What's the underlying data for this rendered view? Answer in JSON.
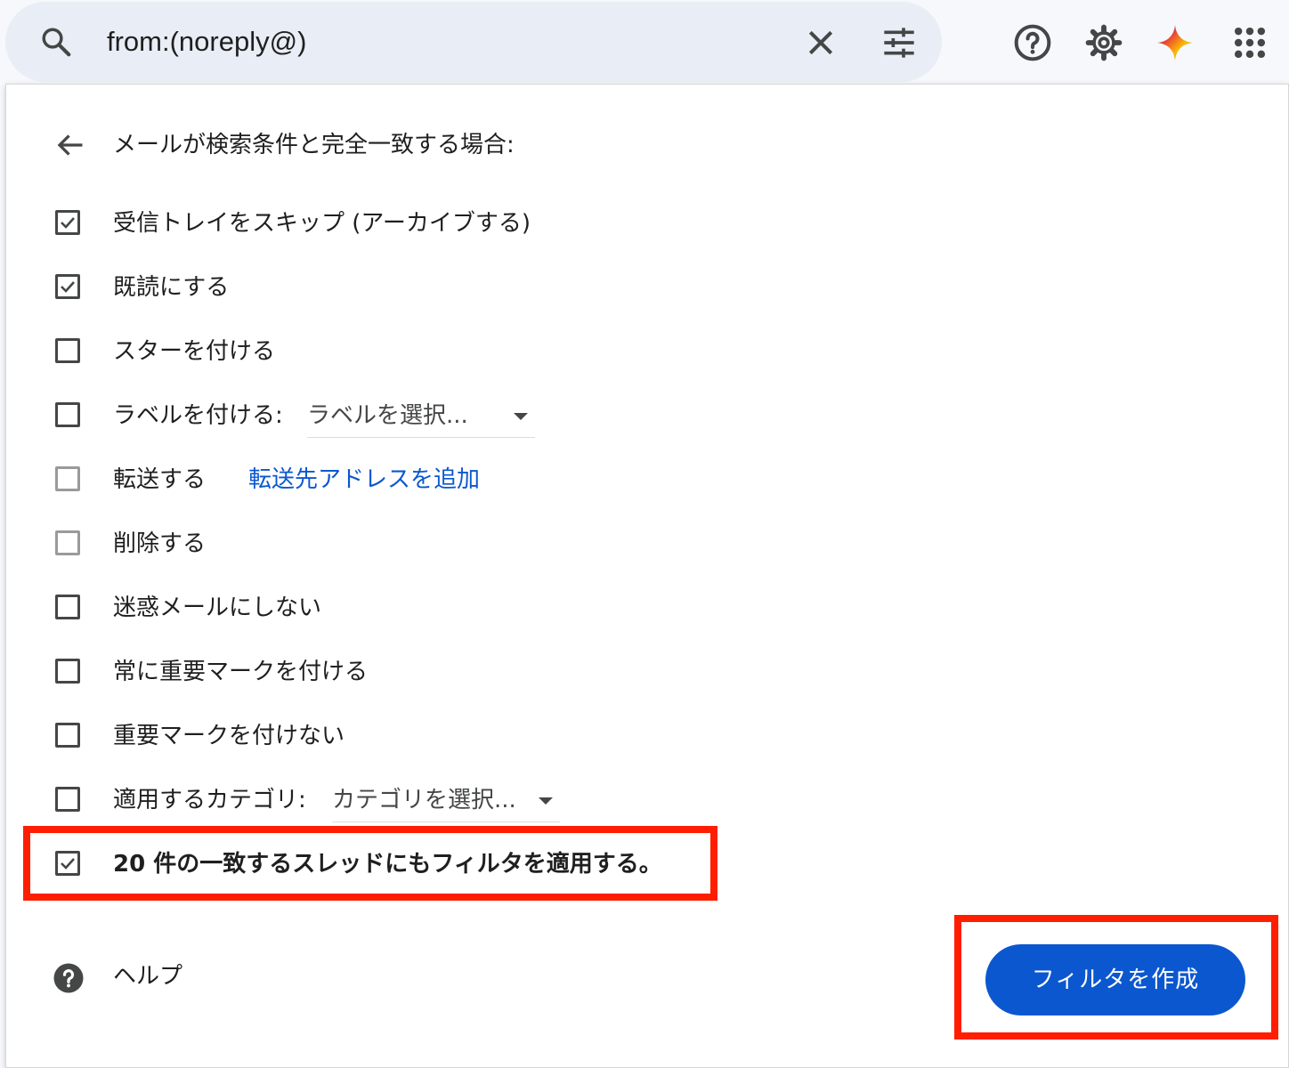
{
  "search": {
    "query": "from:(noreply@)",
    "icons": {
      "search": "search-icon",
      "clear": "close-icon",
      "options": "tune-icon"
    }
  },
  "header_icons": [
    "help-circle-icon",
    "gear-icon",
    "gemini-sparkle-icon",
    "apps-grid-icon"
  ],
  "panel": {
    "heading": "メールが検索条件と完全一致する場合:",
    "options": [
      {
        "label": "受信トレイをスキップ (アーカイブする)",
        "checked": true
      },
      {
        "label": "既読にする",
        "checked": true
      },
      {
        "label": "スターを付ける",
        "checked": false
      },
      {
        "label": "ラベルを付ける:",
        "checked": false,
        "select": "ラベルを選択..."
      },
      {
        "label": "転送する",
        "checked": false,
        "link": "転送先アドレスを追加"
      },
      {
        "label": "削除する",
        "checked": false
      },
      {
        "label": "迷惑メールにしない",
        "checked": false
      },
      {
        "label": "常に重要マークを付ける",
        "checked": false
      },
      {
        "label": "重要マークを付けない",
        "checked": false
      },
      {
        "label": "適用するカテゴリ:",
        "checked": false,
        "select": "カテゴリを選択..."
      },
      {
        "label": "20 件の一致するスレッドにもフィルタを適用する。",
        "checked": true
      }
    ],
    "help_label": "ヘルプ",
    "create_button": "フィルタを作成"
  },
  "colors": {
    "accent": "#0b57d0",
    "highlight": "#ff1e00",
    "searchbar": "#e9eef6"
  }
}
